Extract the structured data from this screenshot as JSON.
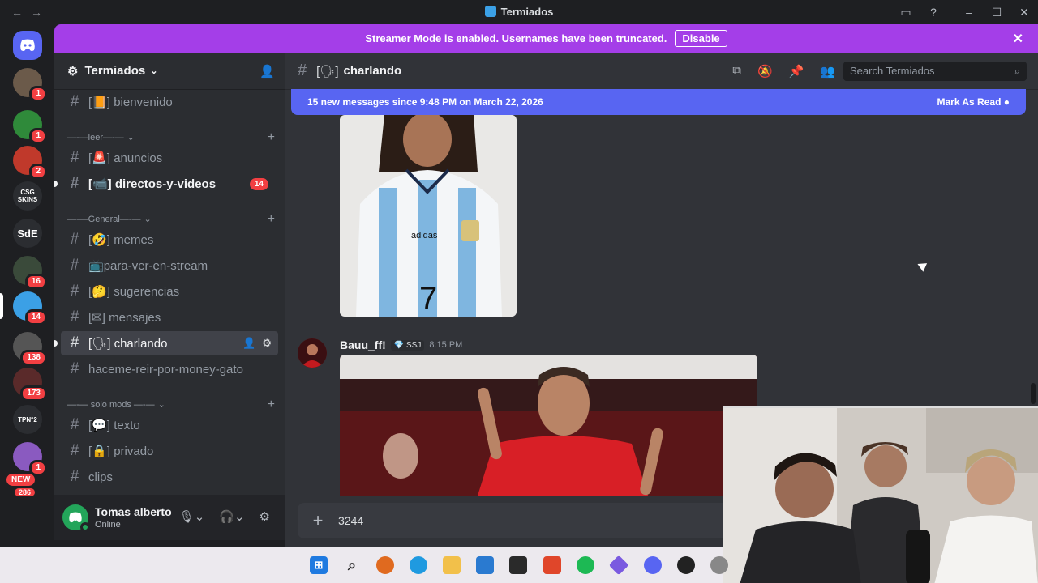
{
  "window": {
    "title": "Termiados"
  },
  "banner": {
    "text": "Streamer Mode is enabled. Usernames have been truncated.",
    "button": "Disable"
  },
  "rail": {
    "servers": [
      {
        "label": "",
        "badge": "1",
        "color": "#6b5a4a"
      },
      {
        "label": "",
        "badge": "1",
        "color": "#2f8a3a"
      },
      {
        "label": "",
        "badge": "2",
        "color": "#c0392b"
      },
      {
        "label": "CSG SKINS",
        "badge": "",
        "color": "#2b2d31"
      },
      {
        "label": "SdE",
        "badge": "",
        "color": "#2b2d31"
      },
      {
        "label": "",
        "badge": "16",
        "color": "#3a4a3a"
      },
      {
        "label": "",
        "badge": "14",
        "color": "#3ba0e6"
      },
      {
        "label": "",
        "badge": "138",
        "color": "#555"
      },
      {
        "label": "",
        "badge": "173",
        "color": "#5a2a2a"
      },
      {
        "label": "TPN°2",
        "badge": "",
        "color": "#2b2d31"
      },
      {
        "label": "",
        "badge": "1",
        "color": "#8a5ac0"
      }
    ],
    "new_badge": "NEW",
    "bottom_count": "286"
  },
  "sidebar": {
    "server_name": "Termiados",
    "channels": [
      {
        "prefix": "[📙]",
        "name": "bienvenido"
      },
      {
        "category": "—-—leer—-—"
      },
      {
        "prefix": "[🚨]",
        "name": "anuncios"
      },
      {
        "prefix": "[📹]",
        "name": "directos-y-videos",
        "count": "14"
      },
      {
        "category": "—-—General—-—"
      },
      {
        "prefix": "[🤣]",
        "name": "memes"
      },
      {
        "prefix": "📺",
        "name": "para-ver-en-stream"
      },
      {
        "prefix": "[🤔]",
        "name": "sugerencias"
      },
      {
        "prefix": "[✉]",
        "name": "mensajes"
      },
      {
        "prefix": "[🗣]",
        "name": "charlando"
      },
      {
        "prefix": "",
        "name": "haceme-reir-por-money-gato"
      },
      {
        "category": "—-— solo mods —-—"
      },
      {
        "prefix": "[💬]",
        "name": "texto"
      },
      {
        "prefix": "[🔒]",
        "name": "privado"
      },
      {
        "prefix": "",
        "name": "clips"
      }
    ]
  },
  "user": {
    "name": "Tomas alberto",
    "status": "Online"
  },
  "channel": {
    "prefix": "[🗣]",
    "name": "charlando",
    "search_placeholder": "Search Termiados",
    "new_messages": "15 new messages since 9:48 PM on March 22, 2026",
    "mark_read": "Mark As Read",
    "message": {
      "author": "Bauu_ff!",
      "tag": "💎 SSJ",
      "time": "8:15 PM"
    },
    "image_caption": "adidas",
    "jersey_number": "7",
    "composer_value": "3244"
  },
  "colors": {
    "accent": "#5865f2",
    "streamer_banner": "#a43ee8",
    "badge_red": "#f23f42",
    "online": "#23a55a"
  }
}
